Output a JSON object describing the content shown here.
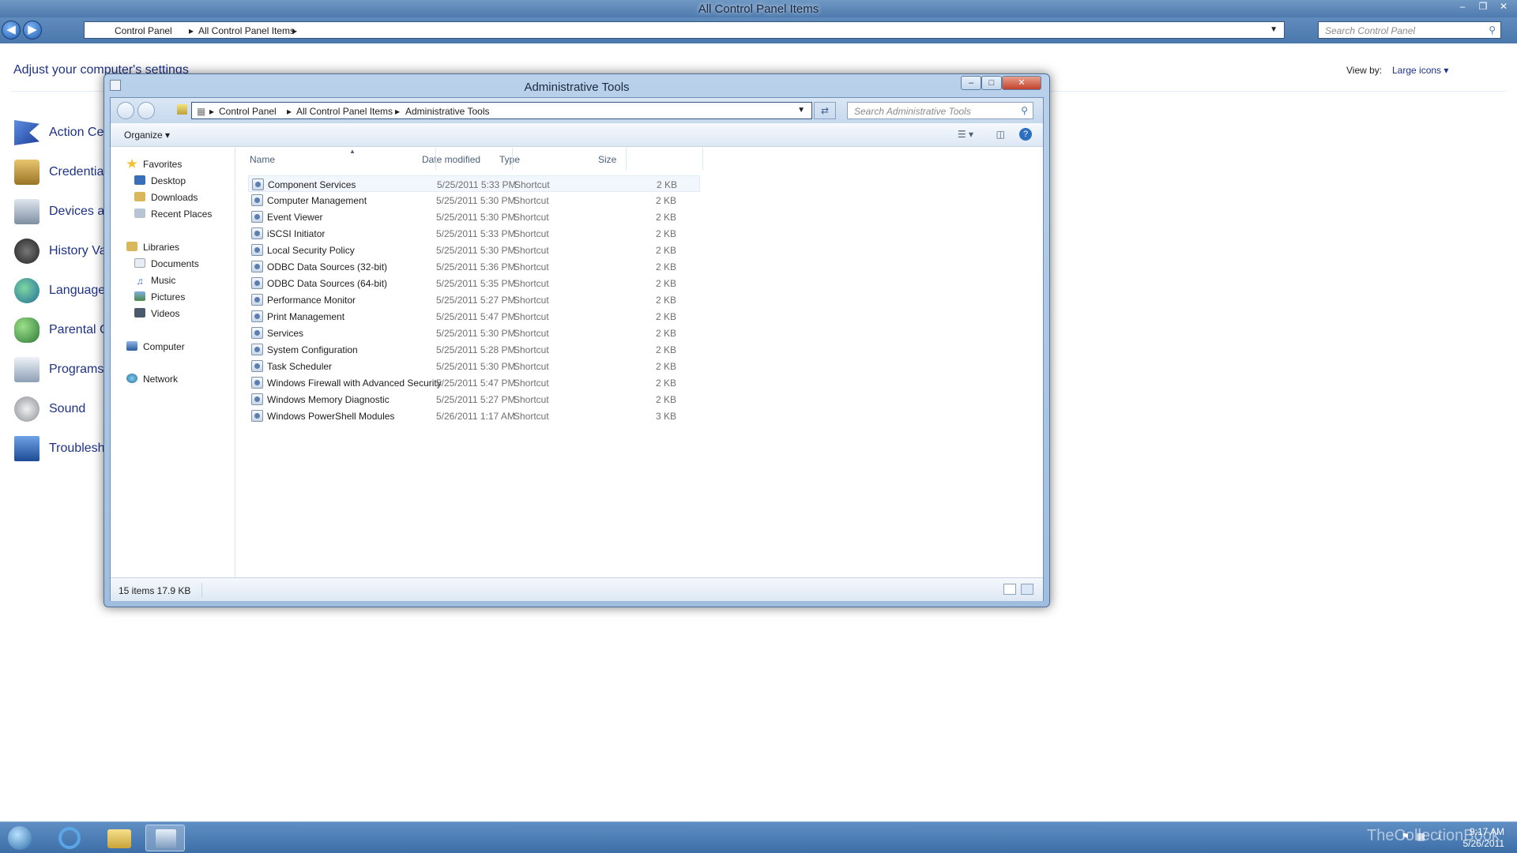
{
  "main_window": {
    "title": "All Control Panel Items",
    "breadcrumb": [
      "Control Panel",
      "All Control Panel Items"
    ],
    "search_placeholder": "Search Control Panel",
    "heading": "Adjust your computer's settings",
    "view_by_label": "View by:",
    "view_by_value": "Large icons",
    "items": [
      {
        "label": "Action Ce",
        "icon": "flag-icon",
        "color": "#2b57b3"
      },
      {
        "label": "Credentia",
        "icon": "credential-vault-icon",
        "color": "#b38a2b"
      },
      {
        "label": "Devices ar",
        "icon": "printer-icon",
        "color": "#6d7f94"
      },
      {
        "label": "History Va",
        "icon": "history-icon",
        "color": "#3a3a3a"
      },
      {
        "label": "Language",
        "icon": "globe-icon",
        "color": "#2d8a4f"
      },
      {
        "label": "Parental C",
        "icon": "parental-controls-icon",
        "color": "#3b9a3c"
      },
      {
        "label": "Programs",
        "icon": "programs-icon",
        "color": "#7d8fa3"
      },
      {
        "label": "Sound",
        "icon": "speaker-icon",
        "color": "#8a8f96"
      },
      {
        "label": "Troublesh",
        "icon": "troubleshoot-icon",
        "color": "#2d5fa8"
      }
    ]
  },
  "explorer": {
    "title": "Administrative Tools",
    "breadcrumb": [
      "Control Panel",
      "All Control Panel Items",
      "Administrative Tools"
    ],
    "search_placeholder": "Search Administrative Tools",
    "organize_label": "Organize",
    "nav": {
      "favorites": {
        "label": "Favorites",
        "items": [
          "Desktop",
          "Downloads",
          "Recent Places"
        ]
      },
      "libraries": {
        "label": "Libraries",
        "items": [
          "Documents",
          "Music",
          "Pictures",
          "Videos"
        ]
      },
      "computer": "Computer",
      "network": "Network"
    },
    "columns": [
      "Name",
      "Date modified",
      "Type",
      "Size"
    ],
    "files": [
      {
        "name": "Component Services",
        "date": "5/25/2011 5:33 PM",
        "type": "Shortcut",
        "size": "2 KB"
      },
      {
        "name": "Computer Management",
        "date": "5/25/2011 5:30 PM",
        "type": "Shortcut",
        "size": "2 KB"
      },
      {
        "name": "Event Viewer",
        "date": "5/25/2011 5:30 PM",
        "type": "Shortcut",
        "size": "2 KB"
      },
      {
        "name": "iSCSI Initiator",
        "date": "5/25/2011 5:33 PM",
        "type": "Shortcut",
        "size": "2 KB"
      },
      {
        "name": "Local Security Policy",
        "date": "5/25/2011 5:30 PM",
        "type": "Shortcut",
        "size": "2 KB"
      },
      {
        "name": "ODBC Data Sources (32-bit)",
        "date": "5/25/2011 5:36 PM",
        "type": "Shortcut",
        "size": "2 KB"
      },
      {
        "name": "ODBC Data Sources (64-bit)",
        "date": "5/25/2011 5:35 PM",
        "type": "Shortcut",
        "size": "2 KB"
      },
      {
        "name": "Performance Monitor",
        "date": "5/25/2011 5:27 PM",
        "type": "Shortcut",
        "size": "2 KB"
      },
      {
        "name": "Print Management",
        "date": "5/25/2011 5:47 PM",
        "type": "Shortcut",
        "size": "2 KB"
      },
      {
        "name": "Services",
        "date": "5/25/2011 5:30 PM",
        "type": "Shortcut",
        "size": "2 KB"
      },
      {
        "name": "System Configuration",
        "date": "5/25/2011 5:28 PM",
        "type": "Shortcut",
        "size": "2 KB"
      },
      {
        "name": "Task Scheduler",
        "date": "5/25/2011 5:30 PM",
        "type": "Shortcut",
        "size": "2 KB"
      },
      {
        "name": "Windows Firewall with Advanced Security",
        "date": "5/25/2011 5:47 PM",
        "type": "Shortcut",
        "size": "2 KB"
      },
      {
        "name": "Windows Memory Diagnostic",
        "date": "5/25/2011 5:27 PM",
        "type": "Shortcut",
        "size": "2 KB"
      },
      {
        "name": "Windows PowerShell Modules",
        "date": "5/26/2011 1:17 AM",
        "type": "Shortcut",
        "size": "3 KB"
      }
    ],
    "status": "15 items  17.9 KB"
  },
  "taskbar": {
    "time": "9:17 AM",
    "date": "5/26/2011",
    "watermark": "TheCollectionBook"
  },
  "colors": {
    "link": "#1e3287",
    "titlebar": "#5f8bbd",
    "taskbar": "#4a7cb4"
  }
}
